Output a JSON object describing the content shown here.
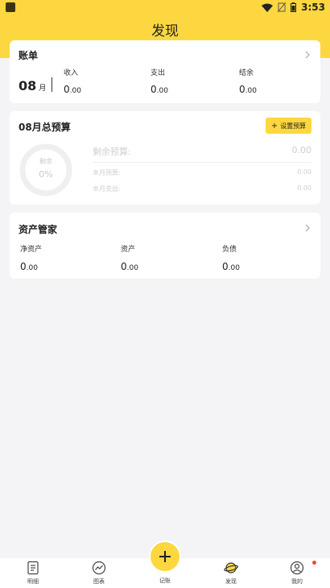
{
  "status": {
    "time": "3:53"
  },
  "header": {
    "title": "发现"
  },
  "bill": {
    "title": "账单",
    "month": "08",
    "month_unit": "月",
    "income_label": "收入",
    "income_int": "0",
    "income_dec": ".00",
    "expense_label": "支出",
    "expense_int": "0",
    "expense_dec": ".00",
    "balance_label": "结余",
    "balance_int": "0",
    "balance_dec": ".00"
  },
  "budget": {
    "title": "08月总预算",
    "set_button": "设置预算",
    "ring_label": "剩余",
    "ring_percent": "0%",
    "remaining_label": "剩余预算:",
    "remaining_value": "0.00",
    "month_budget_label": "本月预算:",
    "month_budget_value": "0.00",
    "month_expense_label": "本月支出:",
    "month_expense_value": "0.00"
  },
  "assets": {
    "title": "资产管家",
    "net_label": "净资产",
    "net_int": "0",
    "net_dec": ".00",
    "asset_label": "资产",
    "asset_int": "0",
    "asset_dec": ".00",
    "debt_label": "负债",
    "debt_int": "0",
    "debt_dec": ".00"
  },
  "nav": {
    "items": [
      {
        "label": "明细",
        "icon": "list-icon"
      },
      {
        "label": "图表",
        "icon": "chart-icon"
      },
      {
        "label": "记账",
        "icon": "plus-icon"
      },
      {
        "label": "发现",
        "icon": "planet-icon"
      },
      {
        "label": "我的",
        "icon": "user-icon"
      }
    ],
    "active_index": 3
  },
  "colors": {
    "accent": "#fcd73f",
    "background": "#f4f4f6",
    "badge": "#f0483e"
  }
}
